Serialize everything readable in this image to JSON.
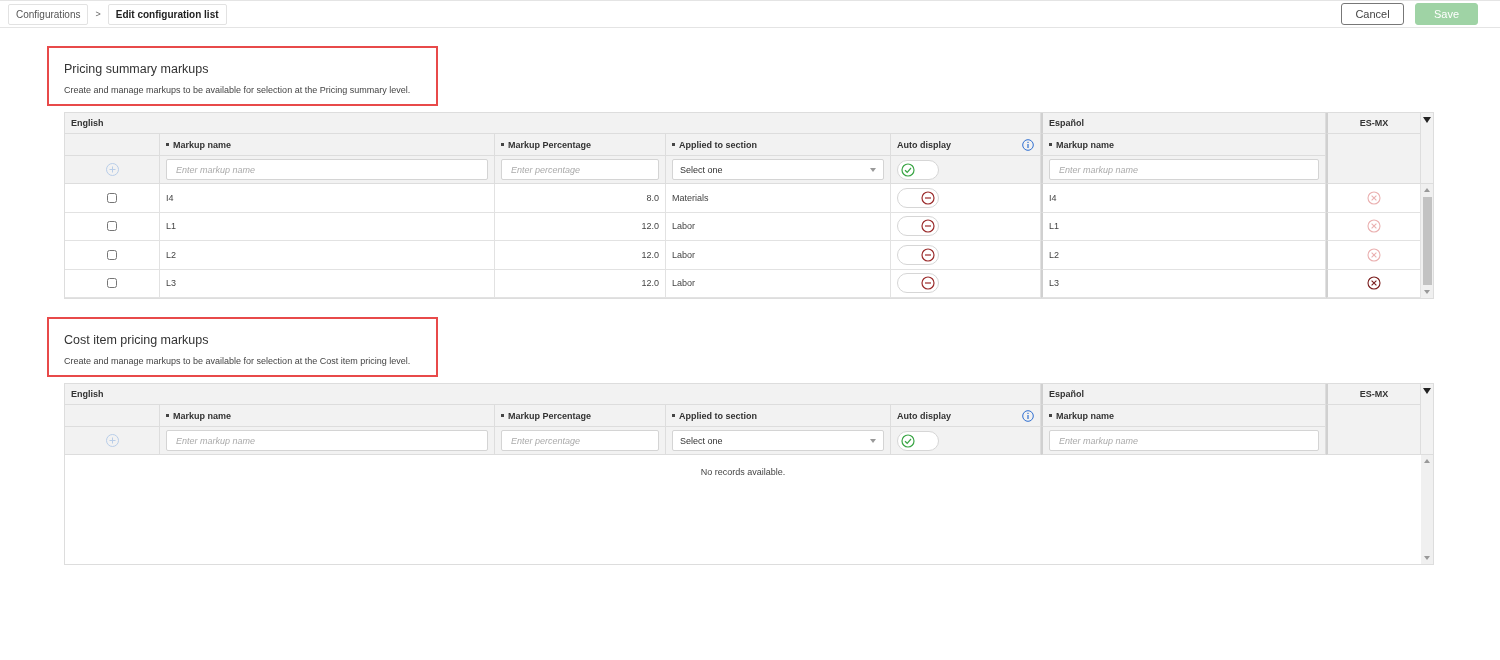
{
  "breadcrumb": [
    {
      "label": "Configurations",
      "selected": false
    },
    {
      "label": "Edit configuration list",
      "selected": true
    }
  ],
  "breadcrumb_separator": ">",
  "buttons": [
    {
      "kind": "cancel",
      "label": "Cancel",
      "disabled": false
    },
    {
      "kind": "save",
      "label": "Save",
      "disabled": true
    }
  ],
  "sections": [
    {
      "title": "Pricing summary markups",
      "description": "Create and manage markups to be available for selection at the Pricing summary level.",
      "highlighted": true,
      "table": {
        "group_headers": [
          "English",
          "Español",
          "ES-MX"
        ],
        "columns": [
          {
            "label": "Markup name",
            "required": true,
            "info": false
          },
          {
            "label": "Markup Percentage",
            "required": true,
            "info": false
          },
          {
            "label": "Applied to section",
            "required": true,
            "info": false
          },
          {
            "label": "Auto display",
            "required": false,
            "info": true
          },
          {
            "label": "Markup name",
            "required": true,
            "info": false
          }
        ],
        "new_row": {
          "name_placeholder": "Enter markup name",
          "percentage_placeholder": "Enter percentage",
          "section_value": "Select one",
          "auto_display_on": true,
          "es_name_placeholder": "Enter markup name"
        },
        "rows": [
          {
            "checked": false,
            "name": "I4",
            "percentage": "8.0",
            "section": "Materials",
            "auto_display_on": false,
            "es_name": "I4",
            "delete_disabled": true
          },
          {
            "checked": false,
            "name": "L1",
            "percentage": "12.0",
            "section": "Labor",
            "auto_display_on": false,
            "es_name": "L1",
            "delete_disabled": true
          },
          {
            "checked": false,
            "name": "L2",
            "percentage": "12.0",
            "section": "Labor",
            "auto_display_on": false,
            "es_name": "L2",
            "delete_disabled": true
          },
          {
            "checked": false,
            "name": "L3",
            "percentage": "12.0",
            "section": "Labor",
            "auto_display_on": false,
            "es_name": "L3",
            "delete_disabled": false
          }
        ]
      }
    },
    {
      "title": "Cost item pricing markups",
      "description": "Create and manage markups to be available for selection at the Cost item pricing level.",
      "highlighted": true,
      "table": {
        "group_headers": [
          "English",
          "Español",
          "ES-MX"
        ],
        "columns": [
          {
            "label": "Markup name",
            "required": true,
            "info": false
          },
          {
            "label": "Markup Percentage",
            "required": true,
            "info": false
          },
          {
            "label": "Applied to section",
            "required": true,
            "info": false
          },
          {
            "label": "Auto display",
            "required": false,
            "info": true
          },
          {
            "label": "Markup name",
            "required": true,
            "info": false
          }
        ],
        "new_row": {
          "name_placeholder": "Enter markup name",
          "percentage_placeholder": "Enter percentage",
          "section_value": "Select one",
          "auto_display_on": true,
          "es_name_placeholder": "Enter markup name"
        },
        "empty_message": "No records available."
      }
    }
  ]
}
